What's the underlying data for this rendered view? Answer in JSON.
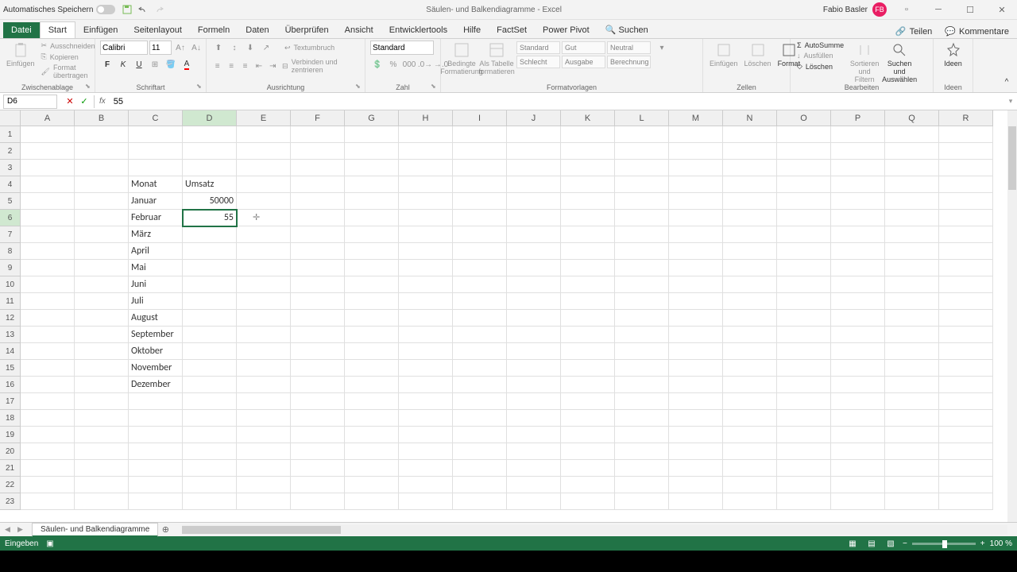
{
  "titlebar": {
    "autosave": "Automatisches Speichern",
    "doc_title": "Säulen- und Balkendiagramme - Excel",
    "user_name": "Fabio Basler",
    "user_initials": "FB"
  },
  "tabs": {
    "file": "Datei",
    "list": [
      "Start",
      "Einfügen",
      "Seitenlayout",
      "Formeln",
      "Daten",
      "Überprüfen",
      "Ansicht",
      "Entwicklertools",
      "Hilfe",
      "FactSet",
      "Power Pivot"
    ],
    "search": "Suchen",
    "share": "Teilen",
    "comments": "Kommentare"
  },
  "ribbon": {
    "clipboard": {
      "paste": "Einfügen",
      "cut": "Ausschneiden",
      "copy": "Kopieren",
      "format": "Format übertragen",
      "label": "Zwischenablage"
    },
    "font": {
      "name": "Calibri",
      "size": "11",
      "label": "Schriftart"
    },
    "align": {
      "wrap": "Textumbruch",
      "merge": "Verbinden und zentrieren",
      "label": "Ausrichtung"
    },
    "number": {
      "format": "Standard",
      "label": "Zahl"
    },
    "styles": {
      "cond": "Bedingte\nFormatierung",
      "table": "Als Tabelle\nformatieren",
      "s1": "Standard",
      "s2": "Gut",
      "s3": "Neutral",
      "s4": "Schlecht",
      "s5": "Ausgabe",
      "s6": "Berechnung",
      "label": "Formatvorlagen"
    },
    "cells": {
      "insert": "Einfügen",
      "delete": "Löschen",
      "format": "Format",
      "label": "Zellen"
    },
    "editing": {
      "sum": "AutoSumme",
      "fill": "Ausfüllen",
      "clear": "Löschen",
      "sort": "Sortieren und\nFiltern",
      "find": "Suchen und\nAuswählen",
      "label": "Bearbeiten"
    },
    "ideas": {
      "btn": "Ideen",
      "label": "Ideen"
    }
  },
  "formula": {
    "cell_ref": "D6",
    "value": "55"
  },
  "grid": {
    "cols": [
      "A",
      "B",
      "C",
      "D",
      "E",
      "F",
      "G",
      "H",
      "I",
      "J",
      "K",
      "L",
      "M",
      "N",
      "O",
      "P",
      "Q",
      "R"
    ],
    "active_col": 3,
    "active_row": 5,
    "data": {
      "C4": "Monat",
      "D4": "Umsatz",
      "C5": "Januar",
      "D5": "50000",
      "C6": "Februar",
      "D6": "55",
      "C7": "März",
      "C8": "April",
      "C9": "Mai",
      "C10": "Juni",
      "C11": "Juli",
      "C12": "August",
      "C13": "September",
      "C14": "Oktober",
      "C15": "November",
      "C16": "Dezember"
    }
  },
  "sheet": {
    "name": "Säulen- und Balkendiagramme"
  },
  "status": {
    "mode": "Eingeben",
    "zoom": "100 %"
  }
}
